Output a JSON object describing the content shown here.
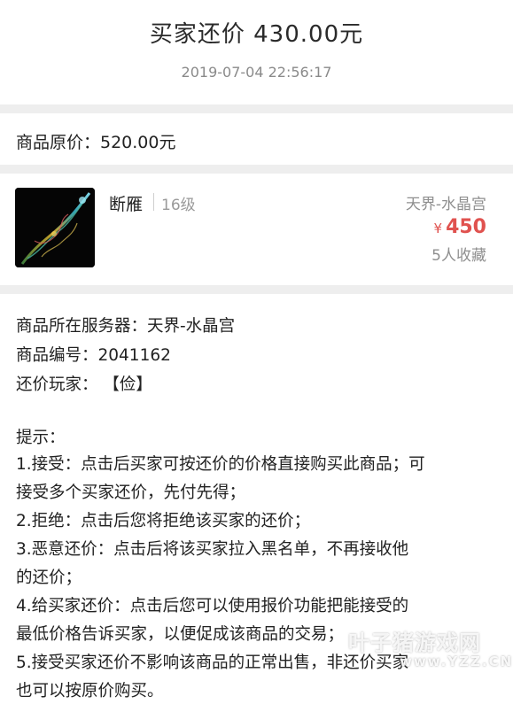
{
  "header": {
    "title": "买家还价  430.00元",
    "time": "2019-07-04 22:56:17"
  },
  "original_price": {
    "text": "商品原价：520.00元"
  },
  "item": {
    "thumb_icon": "weapon-thumbnail",
    "name": "断雁",
    "level": "16级",
    "server": "天界-水晶宫",
    "currency_symbol": "¥",
    "price": "450",
    "favorites": "5人收藏",
    "price_color": "#e0524f"
  },
  "info": {
    "server": "商品所在服务器：天界-水晶宫",
    "code": "商品编号：2041162",
    "player": "还价玩家：  【俭】",
    "tips_title": "提示：",
    "tips": [
      "1.接受：点击后买家可按还价的价格直接购买此商品；可",
      "接受多个买家还价，先付先得；",
      "2.拒绝：点击后您将拒绝该买家的还价；",
      "3.恶意还价：点击后将该买家拉入黑名单，不再接收他",
      "的还价；",
      "4.给买家还价：点击后您可以使用报价功能把能接受的",
      "最低价格告诉买家，以便促成该商品的交易；",
      "5.接受买家还价不影响该商品的正常出售，非还价买家",
      "也可以按原价购买。"
    ]
  },
  "watermark": {
    "cn": "叶子猪游戏网",
    "en": "www.YZZ.CN"
  }
}
